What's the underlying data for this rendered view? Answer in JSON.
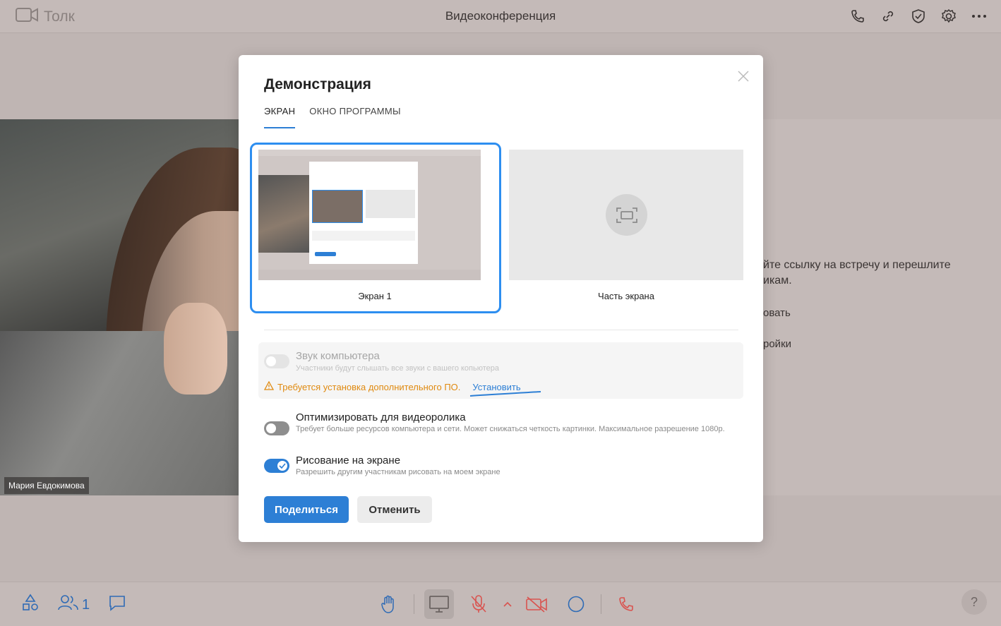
{
  "app": {
    "logo_text": "Толк",
    "window_title": "Видеоконференция"
  },
  "top_icons": [
    "phone-icon",
    "link-icon",
    "shield-check-icon",
    "gear-icon",
    "more-icon"
  ],
  "video": {
    "participant_name": "Мария Евдокимова"
  },
  "background_text": {
    "line1": "йте ссылку на встречу и перешлите",
    "line2": "икам.",
    "item1": "овать",
    "item2": "ройки"
  },
  "modal": {
    "title": "Демонстрация",
    "tabs": [
      {
        "label": "ЭКРАН",
        "active": true
      },
      {
        "label": "ОКНО ПРОГРАММЫ",
        "active": false
      }
    ],
    "sources": [
      {
        "label": "Экран 1",
        "selected": true
      },
      {
        "label": "Часть экрана",
        "selected": false
      }
    ],
    "options": [
      {
        "title": "Звук компьютера",
        "subtitle": "Участники будут слышать все звуки с вашего копьютера",
        "enabled": false,
        "disabled": true
      },
      {
        "title": "Оптимизировать для видеоролика",
        "subtitle": "Требует больше ресурсов компьютера и сети. Может снижаться четкость картинки. Максимальное разрешение 1080p.",
        "enabled": false,
        "disabled": false
      },
      {
        "title": "Рисование на экране",
        "subtitle": "Разрешить другим участникам рисовать на моем экране",
        "enabled": true,
        "disabled": false
      }
    ],
    "warning": {
      "text": "Требуется установка дополнительного ПО.",
      "link": "Установить"
    },
    "share_label": "Поделиться",
    "cancel_label": "Отменить"
  },
  "bottom_bar": {
    "participants_count": "1",
    "help_label": "?"
  },
  "colors": {
    "accent": "#2d7fd5",
    "warning": "#e08a10",
    "danger": "#d9534f"
  }
}
